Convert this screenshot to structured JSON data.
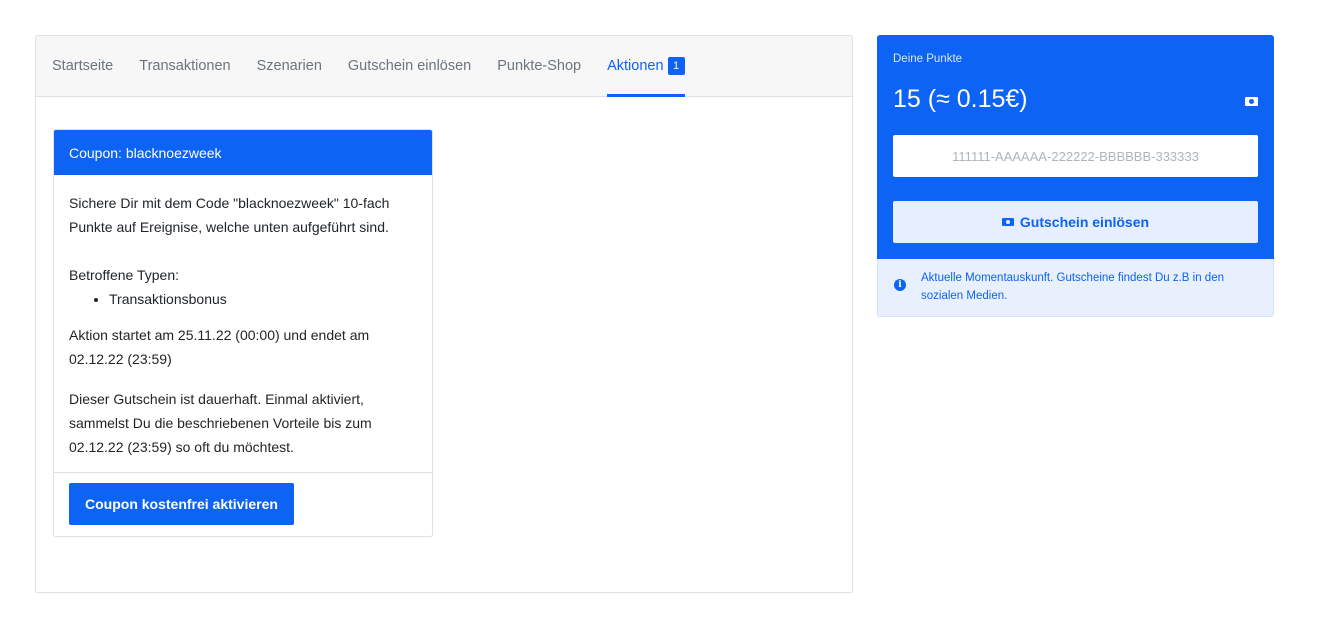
{
  "tabs": [
    {
      "label": "Startseite",
      "active": false
    },
    {
      "label": "Transaktionen",
      "active": false
    },
    {
      "label": "Szenarien",
      "active": false
    },
    {
      "label": "Gutschein einlösen",
      "active": false
    },
    {
      "label": "Punkte-Shop",
      "active": false
    },
    {
      "label": "Aktionen",
      "active": true,
      "badge": "1"
    }
  ],
  "coupon": {
    "header": "Coupon: blacknoezweek",
    "description": "Sichere Dir mit dem Code \"blacknoezweek\" 10-fach Punkte auf Ereignise, welche unten aufgeführt sind.",
    "types_label": "Betroffene Typen:",
    "types": [
      "Transaktionsbonus"
    ],
    "dates": "Aktion startet am 25.11.22 (00:00) und endet am 02.12.22 (23:59)",
    "permanent_note": "Dieser Gutschein ist dauerhaft. Einmal aktiviert, sammelst Du die beschriebenen Vorteile bis zum 02.12.22 (23:59) so oft du möchtest.",
    "activate_label": "Coupon kostenfrei aktivieren"
  },
  "points": {
    "label": "Deine Punkte",
    "value": "15 (≈ 0.15€)",
    "icon": "money-icon",
    "input_placeholder": "111111-AAAAAA-222222-BBBBBB-333333",
    "input_value": "",
    "redeem_label": "Gutschein einlösen"
  },
  "info": {
    "icon": "info-icon",
    "text": "Aktuelle Momentauskunft. Gutscheine findest Du z.B in den sozialen Medien."
  },
  "colors": {
    "primary": "#0d63f3",
    "tab_inactive": "#6c757d",
    "info_bg": "#e8f0fd"
  }
}
